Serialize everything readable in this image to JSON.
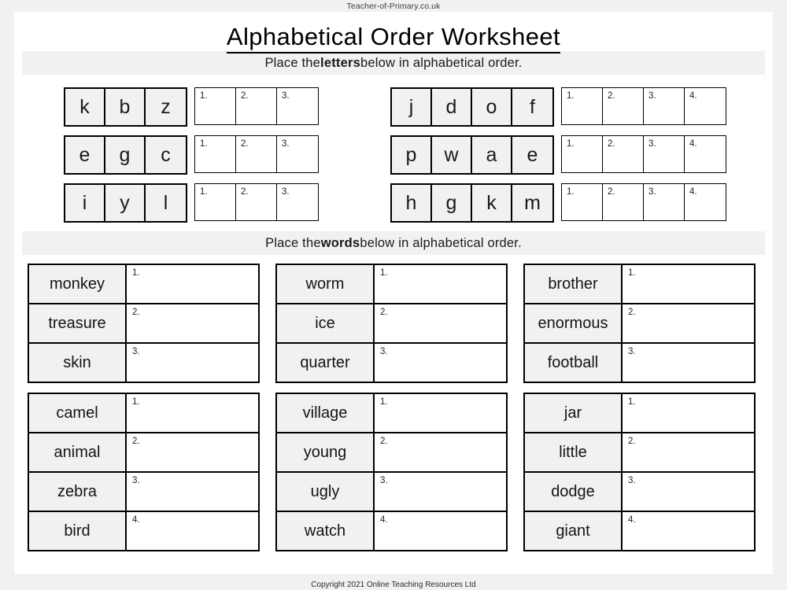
{
  "site_header": "Teacher-of-Primary.co.uk",
  "site_footer": "Copyright 2021 Online Teaching Resources Ltd",
  "title": "Alphabetical Order Worksheet",
  "sections": {
    "letters": {
      "instruction_before": "Place the ",
      "instruction_bold": "letters",
      "instruction_after": " below in alphabetical order.",
      "left_rows": [
        {
          "letters": [
            "k",
            "b",
            "z"
          ],
          "answers": [
            "1.",
            "2.",
            "3."
          ]
        },
        {
          "letters": [
            "e",
            "g",
            "c"
          ],
          "answers": [
            "1.",
            "2.",
            "3."
          ]
        },
        {
          "letters": [
            "i",
            "y",
            "l"
          ],
          "answers": [
            "1.",
            "2.",
            "3."
          ]
        }
      ],
      "right_rows": [
        {
          "letters": [
            "j",
            "d",
            "o",
            "f"
          ],
          "answers": [
            "1.",
            "2.",
            "3.",
            "4."
          ]
        },
        {
          "letters": [
            "p",
            "w",
            "a",
            "e"
          ],
          "answers": [
            "1.",
            "2.",
            "3.",
            "4."
          ]
        },
        {
          "letters": [
            "h",
            "g",
            "k",
            "m"
          ],
          "answers": [
            "1.",
            "2.",
            "3.",
            "4."
          ]
        }
      ]
    },
    "words": {
      "instruction_before": "Place the ",
      "instruction_bold": "words",
      "instruction_after": " below in alphabetical order.",
      "groups": [
        {
          "words": [
            "monkey",
            "treasure",
            "skin"
          ],
          "answers": [
            "1.",
            "2.",
            "3."
          ]
        },
        {
          "words": [
            "worm",
            "ice",
            "quarter"
          ],
          "answers": [
            "1.",
            "2.",
            "3."
          ]
        },
        {
          "words": [
            "brother",
            "enormous",
            "football"
          ],
          "answers": [
            "1.",
            "2.",
            "3."
          ]
        },
        {
          "words": [
            "camel",
            "animal",
            "zebra",
            "bird"
          ],
          "answers": [
            "1.",
            "2.",
            "3.",
            "4."
          ]
        },
        {
          "words": [
            "village",
            "young",
            "ugly",
            "watch"
          ],
          "answers": [
            "1.",
            "2.",
            "3.",
            "4."
          ]
        },
        {
          "words": [
            "jar",
            "little",
            "dodge",
            "giant"
          ],
          "answers": [
            "1.",
            "2.",
            "3.",
            "4."
          ]
        }
      ]
    }
  },
  "colors": {
    "page_background": "#ffffff",
    "outer_background": "#f1f1f1",
    "tile_fill": "#f1f1f1",
    "ink": "#000000"
  }
}
